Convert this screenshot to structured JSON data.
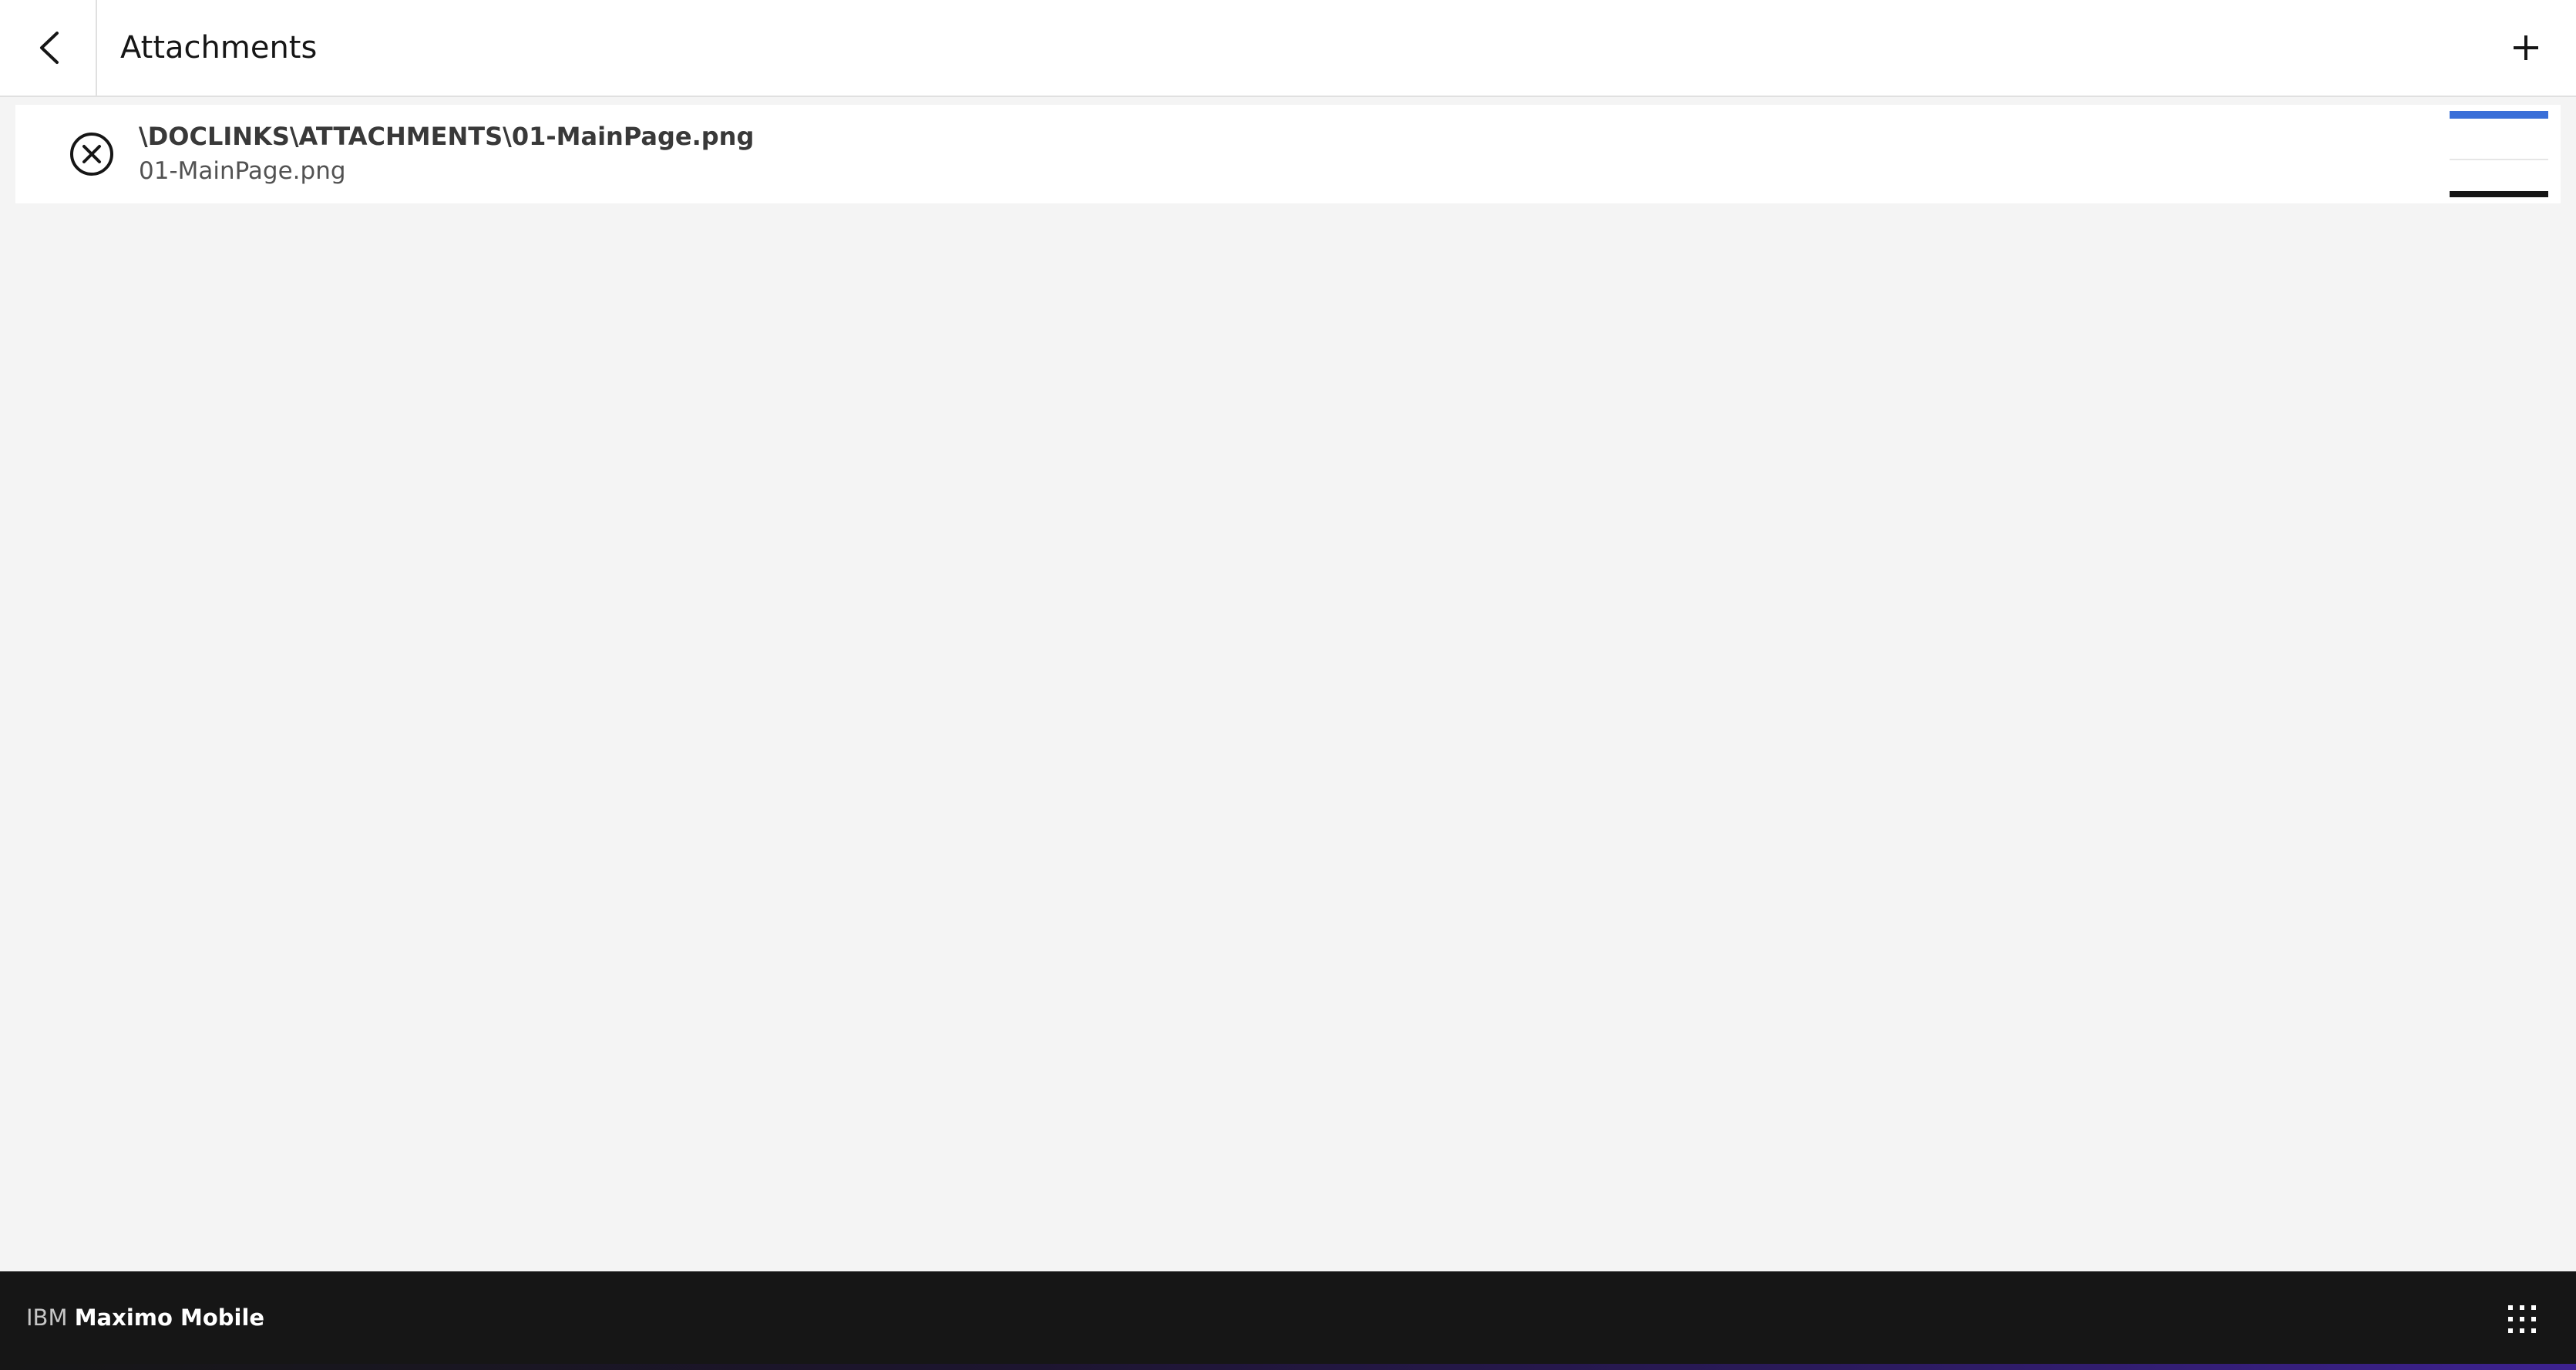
{
  "header": {
    "title": "Attachments",
    "back_icon": "chevron-left-icon",
    "add_icon": "plus-icon"
  },
  "attachments": [
    {
      "path": "\\DOCLINKS\\ATTACHMENTS\\01-MainPage.png",
      "filename": "01-MainPage.png",
      "remove_icon": "close-circle-icon"
    }
  ],
  "footer": {
    "brand_company": "IBM",
    "brand_product": "Maximo Mobile",
    "switcher_icon": "app-switcher-grid-icon"
  },
  "colors": {
    "background": "#f4f4f4",
    "surface": "#ffffff",
    "footer": "#161616",
    "text_primary": "#161616",
    "accent": "#3a6fd8"
  }
}
